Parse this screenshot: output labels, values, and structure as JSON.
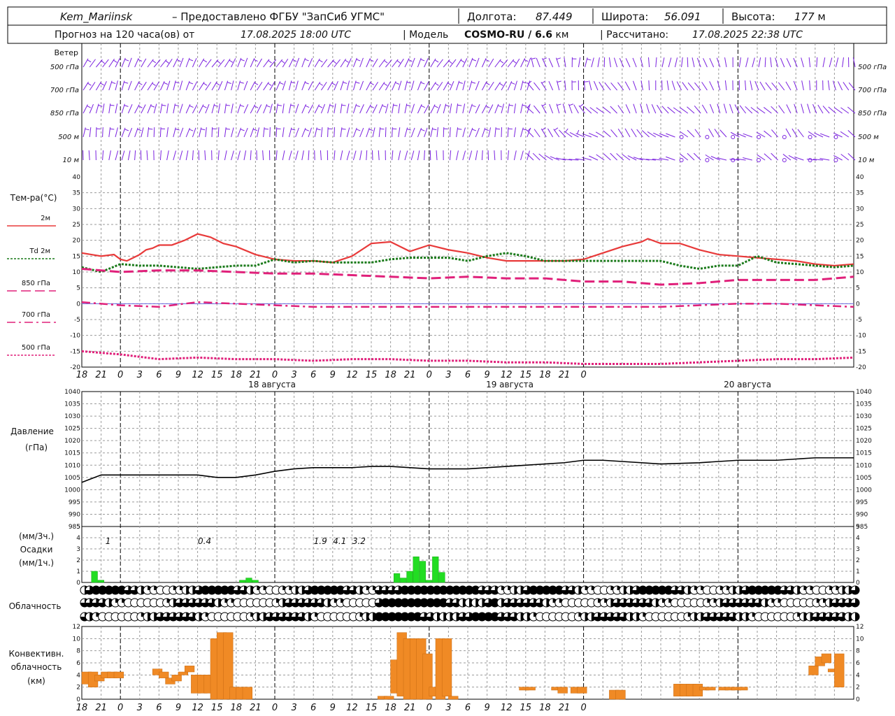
{
  "header": {
    "station": "Kem_Mariinsk",
    "provider": "– Предоставлено ФГБУ \"ЗапСиб УГМС\"",
    "lon_label": "Долгота:",
    "lon_value": "87.449",
    "lat_label": "Широта:",
    "lat_value": "56.091",
    "alt_label": "Высота:",
    "alt_value": "177",
    "alt_unit": "м",
    "forecast_label": "Прогноз на 120 часа(ов) от",
    "forecast_from": "17.08.2025 18:00 UTC",
    "model_label": "| Модель",
    "model_name": "COSMO-RU / 6.6",
    "model_unit": "км",
    "computed_label": "| Рассчитано:",
    "computed_value": "17.08.2025 22:38 UTC"
  },
  "panels": {
    "wind": {
      "title": "Ветер",
      "levels": [
        "500 гПа",
        "700 гПа",
        "850 гПа",
        "500  м",
        "10  м"
      ],
      "colors": {
        "barb": "#7a20e0"
      }
    },
    "temperature": {
      "title": "Тем-ра(°C)",
      "legend": [
        {
          "label": "2м",
          "color": "#e83a3a",
          "style": "solid"
        },
        {
          "label": "Td  2м",
          "color": "#1a7a1a",
          "style": "dotted"
        },
        {
          "label": "850 гПа",
          "color": "#e0207a",
          "style": "dashed"
        },
        {
          "label": "700 гПа",
          "color": "#e0207a",
          "style": "dashdot"
        },
        {
          "label": "500 гПа",
          "color": "#e0207a",
          "style": "dotted"
        }
      ]
    },
    "pressure": {
      "title1": "Давление",
      "title2": "(гПа)"
    },
    "precip": {
      "title1": "(мм/3ч.)",
      "title2": "Осадки",
      "title3": "(мм/1ч.)",
      "labels": [
        {
          "x": 3,
          "text": "1"
        },
        {
          "x": 18,
          "text": "0.4"
        },
        {
          "x": 36,
          "text": "1.9"
        },
        {
          "x": 39,
          "text": "4.1"
        },
        {
          "x": 42,
          "text": "3.2"
        }
      ]
    },
    "clouds": {
      "title": "Облачность"
    },
    "convective": {
      "title1": "Конвективн.",
      "title2": "облачность",
      "title3": "(км)"
    }
  },
  "x_axis": {
    "tick_labels": [
      "18",
      "21",
      "0",
      "3",
      "6",
      "9",
      "12",
      "15",
      "18",
      "21",
      "0",
      "3",
      "6",
      "9",
      "12",
      "15",
      "18",
      "21",
      "0",
      "3",
      "6",
      "9",
      "12",
      "15",
      "18",
      "21",
      "0"
    ],
    "dates": [
      "18 августа",
      "19 августа",
      "20 августа"
    ]
  },
  "chart_data": [
    {
      "type": "line",
      "title": "Тем-ра(°C)",
      "xlabel": "",
      "ylabel": "Тем-ра(°C)",
      "x_unit": "hours from 17.08.2025 18:00 UTC",
      "ylim": [
        -20,
        40
      ],
      "yticks": [
        -20,
        -15,
        -10,
        -5,
        0,
        5,
        10,
        15,
        20,
        25,
        30,
        35,
        40
      ],
      "series": [
        {
          "name": "2м",
          "x": [
            0,
            3,
            5,
            6,
            7,
            8,
            9,
            10,
            11,
            12,
            14,
            16,
            18,
            19,
            20,
            21,
            22,
            24,
            27,
            30,
            33,
            36,
            39,
            42,
            45,
            48,
            51,
            54,
            57,
            60,
            63,
            66,
            69,
            72,
            75,
            78,
            81,
            84,
            87,
            88,
            90,
            93,
            96,
            99,
            102,
            105,
            108,
            111,
            114,
            117,
            120
          ],
          "y": [
            16,
            15,
            15.5,
            14,
            13.5,
            14.5,
            15.5,
            17,
            17.5,
            18.5,
            18.5,
            20,
            22,
            21.5,
            21,
            20,
            19,
            18,
            15.5,
            14,
            13.5,
            13.5,
            13,
            15,
            19,
            19.5,
            16.5,
            18.5,
            17,
            16,
            14.5,
            13.5,
            13.5,
            13.5,
            13.5,
            14,
            16,
            18,
            19.5,
            20.5,
            19,
            19,
            17,
            15.5,
            15,
            14.5,
            14,
            13.5,
            12.5,
            12,
            12.5
          ]
        },
        {
          "name": "Td  2м",
          "x": [
            0,
            3,
            6,
            9,
            12,
            15,
            18,
            21,
            24,
            27,
            30,
            33,
            36,
            39,
            42,
            45,
            48,
            51,
            54,
            57,
            60,
            63,
            66,
            69,
            72,
            75,
            78,
            81,
            84,
            87,
            90,
            93,
            96,
            99,
            102,
            105,
            108,
            111,
            114,
            117,
            120
          ],
          "y": [
            11.5,
            10,
            12.5,
            12,
            12,
            11.5,
            11,
            11.5,
            12,
            12,
            14,
            13,
            13.5,
            13,
            13,
            13,
            14,
            14.5,
            14.5,
            14.5,
            13.5,
            15,
            16,
            15,
            13.5,
            13.5,
            13.5,
            13.5,
            13.5,
            13.5,
            13.5,
            12,
            11,
            12,
            12,
            15,
            13,
            12.5,
            12,
            11.5,
            12
          ]
        },
        {
          "name": "850 гПа",
          "x": [
            0,
            6,
            12,
            18,
            24,
            30,
            36,
            42,
            48,
            54,
            60,
            66,
            72,
            78,
            84,
            90,
            96,
            102,
            108,
            114,
            120
          ],
          "y": [
            11,
            10,
            10.5,
            10.5,
            10,
            9.5,
            9.5,
            9,
            8.5,
            8,
            8.5,
            8,
            8,
            7,
            7,
            6,
            6.5,
            7.5,
            7.5,
            7.5,
            8.5
          ]
        },
        {
          "name": "700 гПа",
          "x": [
            0,
            6,
            12,
            18,
            24,
            30,
            36,
            42,
            48,
            54,
            60,
            66,
            72,
            78,
            84,
            90,
            96,
            102,
            108,
            114,
            120
          ],
          "y": [
            0.5,
            -0.5,
            -1,
            0.5,
            0,
            -0.5,
            -1,
            -1,
            -1,
            -1,
            -1,
            -1,
            -1,
            -1,
            -1,
            -1,
            -0.5,
            0,
            0,
            -0.5,
            -1
          ]
        },
        {
          "name": "500 гПа",
          "x": [
            0,
            6,
            12,
            18,
            24,
            30,
            36,
            42,
            48,
            54,
            60,
            66,
            72,
            78,
            84,
            90,
            96,
            102,
            108,
            114,
            120
          ],
          "y": [
            -15,
            -16,
            -17.5,
            -17,
            -17.5,
            -17.5,
            -18,
            -17.5,
            -17.5,
            -18,
            -18,
            -18.5,
            -18.5,
            -19,
            -19,
            -19,
            -18.5,
            -18,
            -17.5,
            -17.5,
            -17
          ]
        }
      ]
    },
    {
      "type": "line",
      "title": "Давление",
      "ylabel": "(гПа)",
      "x_unit": "hours from 17.08.2025 18:00 UTC",
      "ylim": [
        985,
        1040
      ],
      "yticks": [
        985,
        990,
        995,
        1000,
        1005,
        1010,
        1015,
        1020,
        1025,
        1030,
        1035,
        1040
      ],
      "series": [
        {
          "name": "Давление",
          "x": [
            0,
            3,
            6,
            12,
            18,
            21,
            24,
            27,
            30,
            33,
            36,
            39,
            42,
            45,
            48,
            51,
            54,
            57,
            60,
            66,
            69,
            72,
            75,
            78,
            81,
            84,
            90,
            96,
            102,
            108,
            114,
            120
          ],
          "y": [
            1003,
            1006,
            1006,
            1006,
            1006,
            1005,
            1005,
            1006,
            1007.5,
            1008.5,
            1009,
            1009,
            1009,
            1009.5,
            1009.5,
            1009,
            1008.5,
            1008.5,
            1008.5,
            1009.5,
            1010,
            1010.5,
            1011,
            1012,
            1012,
            1011.5,
            1010.5,
            1011,
            1012,
            1012,
            1013,
            1013
          ]
        }
      ]
    },
    {
      "type": "bar",
      "title": "Осадки",
      "ylabel": "(мм/3ч.) / (мм/1ч.)",
      "x_unit": "hours from 17.08.2025 18:00 UTC",
      "ylim": [
        0,
        5
      ],
      "yticks": [
        0,
        1,
        2,
        3,
        4,
        5
      ],
      "series": [
        {
          "name": "Осадки",
          "x": [
            1.5,
            2.5,
            24.5,
            25.5,
            26.5,
            48.5,
            49.5,
            50.5,
            51.5,
            52.5,
            53.5,
            54.5,
            55.5
          ],
          "values": [
            1,
            0.2,
            0.2,
            0.4,
            0.2,
            0.8,
            0.4,
            1,
            2.3,
            1.9,
            0.2,
            2.3,
            0.9
          ]
        }
      ]
    },
    {
      "type": "bar",
      "title": "Конвективн. облачность (км)",
      "ylabel": "(км)",
      "x_unit": "hours from 17.08.2025 18:00 UTC",
      "ylim": [
        0,
        12
      ],
      "yticks": [
        0,
        2,
        4,
        6,
        8,
        10,
        12
      ],
      "series": [
        {
          "name": "Конвективн. облачность",
          "x": [
            0,
            1,
            2,
            3,
            4,
            5,
            11,
            12,
            13,
            14,
            15,
            16,
            17,
            18,
            19,
            20,
            21,
            22,
            23,
            24,
            25,
            46,
            47,
            48,
            49,
            50,
            51,
            52,
            53,
            54,
            55,
            56,
            57,
            68,
            69,
            73,
            74,
            76,
            77,
            82,
            83,
            92,
            93,
            94,
            95,
            96,
            97,
            99,
            100,
            101,
            102,
            113,
            114,
            115,
            116,
            117
          ],
          "bottom": [
            2.5,
            2,
            3,
            3.5,
            3.5,
            3.5,
            4,
            3.5,
            2.5,
            3,
            4,
            4.5,
            1,
            1,
            1,
            0,
            0,
            0,
            0,
            0,
            0,
            0,
            0,
            1,
            0.5,
            0,
            0,
            0,
            0,
            0.5,
            0,
            0.5,
            0,
            1.5,
            1.5,
            1.5,
            1,
            1,
            1,
            0,
            0,
            0.5,
            0.5,
            0.5,
            0.5,
            1.5,
            1.5,
            1.5,
            1.5,
            1.5,
            1.5,
            4,
            5.5,
            6,
            4.5,
            2
          ],
          "top": [
            4.5,
            4.5,
            4,
            4.5,
            4.5,
            4.5,
            5,
            4.5,
            3.5,
            4,
            4.5,
            5.5,
            4,
            4,
            4,
            10,
            11,
            11,
            2,
            2,
            2,
            0.5,
            0.5,
            6.5,
            11,
            10,
            10,
            10,
            7.5,
            2,
            10,
            10,
            0.5,
            2,
            2,
            2,
            2,
            2,
            2,
            1.5,
            1.5,
            2.5,
            2.5,
            2.5,
            2.5,
            2,
            2,
            2,
            2,
            2,
            2,
            5.5,
            7,
            7.5,
            5,
            7.5
          ]
        }
      ]
    }
  ]
}
